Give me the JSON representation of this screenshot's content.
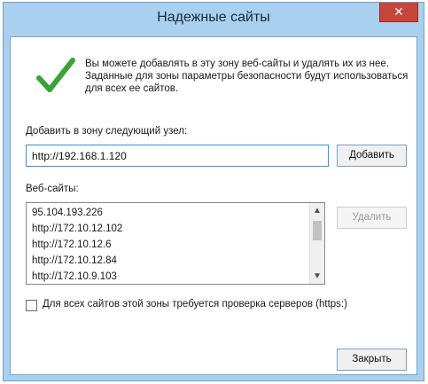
{
  "window": {
    "title": "Надежные сайты",
    "close_glyph": "✕"
  },
  "info": {
    "text": "Вы можете добавлять в эту зону веб-сайты и удалять их из нее. Заданные для зоны параметры безопасности будут использоваться для всех ее сайтов.",
    "icon": "checkmark-icon",
    "icon_color": "#3aa336"
  },
  "add_zone": {
    "label": "Добавить в зону следующий узел:",
    "value": "http://192.168.1.120",
    "button_label": "Добавить"
  },
  "sites": {
    "label": "Веб-сайты:",
    "items": [
      "95.104.193.226",
      "http://172.10.12.102",
      "http://172.10.12.6",
      "http://172.10.12.84",
      "http://172.10.9.103"
    ],
    "remove_label": "Удалить"
  },
  "https_check": {
    "label": "Для всех сайтов этой зоны требуется проверка серверов (https:)",
    "checked": false
  },
  "footer": {
    "close_label": "Закрыть"
  },
  "colors": {
    "frame": "#a9d0ee",
    "close_button": "#c7453a",
    "input_border": "#3b8fd6"
  }
}
